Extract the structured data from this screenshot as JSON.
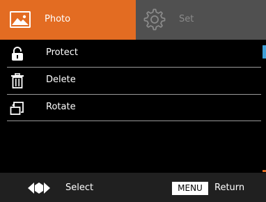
{
  "tabs": {
    "photo": {
      "label": "Photo",
      "icon": "photo-icon",
      "active": true
    },
    "set": {
      "label": "Set",
      "icon": "gear-icon",
      "active": false
    }
  },
  "menu": {
    "items": [
      {
        "label": "Protect",
        "icon": "lock-icon"
      },
      {
        "label": "Delete",
        "icon": "trash-icon"
      },
      {
        "label": "Rotate",
        "icon": "rotate-icon"
      }
    ]
  },
  "footer": {
    "select_label": "Select",
    "menu_key_label": "MENU",
    "return_label": "Return",
    "select_icon": "left-right-arrows-icon"
  },
  "colors": {
    "accent": "#e36c22",
    "inactive_tab": "#505050",
    "scroll": "#3fa0d8",
    "background": "#000000"
  }
}
